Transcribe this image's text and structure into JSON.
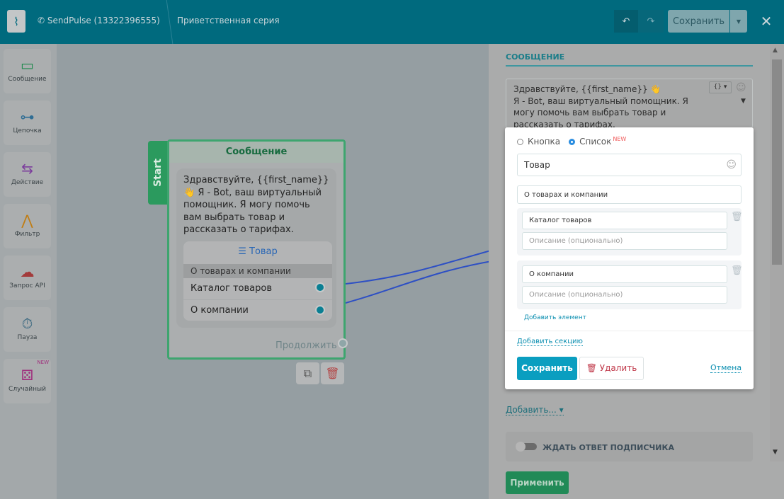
{
  "header": {
    "channel": "SendPulse (13322396555)",
    "flow_title": "Приветственная серия",
    "save_label": "Сохранить",
    "undo": "↶",
    "redo": "↷",
    "close": "✕"
  },
  "sidebar": {
    "items": [
      {
        "label": "Сообщение",
        "icon": "▭",
        "color": "#1f8a4c"
      },
      {
        "label": "Цепочка",
        "icon": "⊶",
        "color": "#2f6d94"
      },
      {
        "label": "Действие",
        "icon": "⇆",
        "color": "#7c3d9c"
      },
      {
        "label": "Фильтр",
        "icon": "⋀",
        "color": "#c07d14"
      },
      {
        "label": "Запрос API",
        "icon": "☁",
        "color": "#a33b3b"
      },
      {
        "label": "Пауза",
        "icon": "⏱",
        "color": "#3a6880"
      },
      {
        "label": "Случайный",
        "icon": "⚄",
        "color": "#a0307d",
        "badge": "NEW"
      }
    ]
  },
  "node": {
    "start": "Start",
    "title": "Сообщение",
    "text": "Здравствуйте,  {{first_name}} 👋 Я - Bot, ваш виртуальный помощник. Я могу помочь вам выбрать товар и рассказать о тарифах.",
    "list_button": "☰ Товар",
    "section": "О товарах и компании",
    "items": [
      "Каталог товаров",
      "О компании"
    ],
    "continue": "Продолжить"
  },
  "panel": {
    "section_title": "СООБЩЕНИЕ",
    "message_line1": "Здравствуйте,  {{first_name}} 👋",
    "message_line2": "Я - Bot, ваш виртуальный  помощник. Я",
    "message_line3": "могу помочь вам выбрать товар и",
    "message_line4": "рассказать о тарифах.",
    "var_button": "{} ▾",
    "add_label": "Добавить...",
    "wait_label": "ЖДАТЬ ОТВЕТ ПОДПИСЧИКА",
    "apply_label": "Применить"
  },
  "popup": {
    "radio_button": "Кнопка",
    "radio_list": "Список",
    "new_badge": "NEW",
    "list_title": "Товар",
    "section_title": "О товарах и компании",
    "items": [
      {
        "title": "Каталог товаров",
        "desc_placeholder": "Описание (опционально)"
      },
      {
        "title": "О компании",
        "desc_placeholder": "Описание (опционально)"
      }
    ],
    "add_element": "Добавить элемент",
    "add_section": "Добавить секцию",
    "save": "Сохранить",
    "delete": "Удалить",
    "cancel": "Отмена"
  }
}
